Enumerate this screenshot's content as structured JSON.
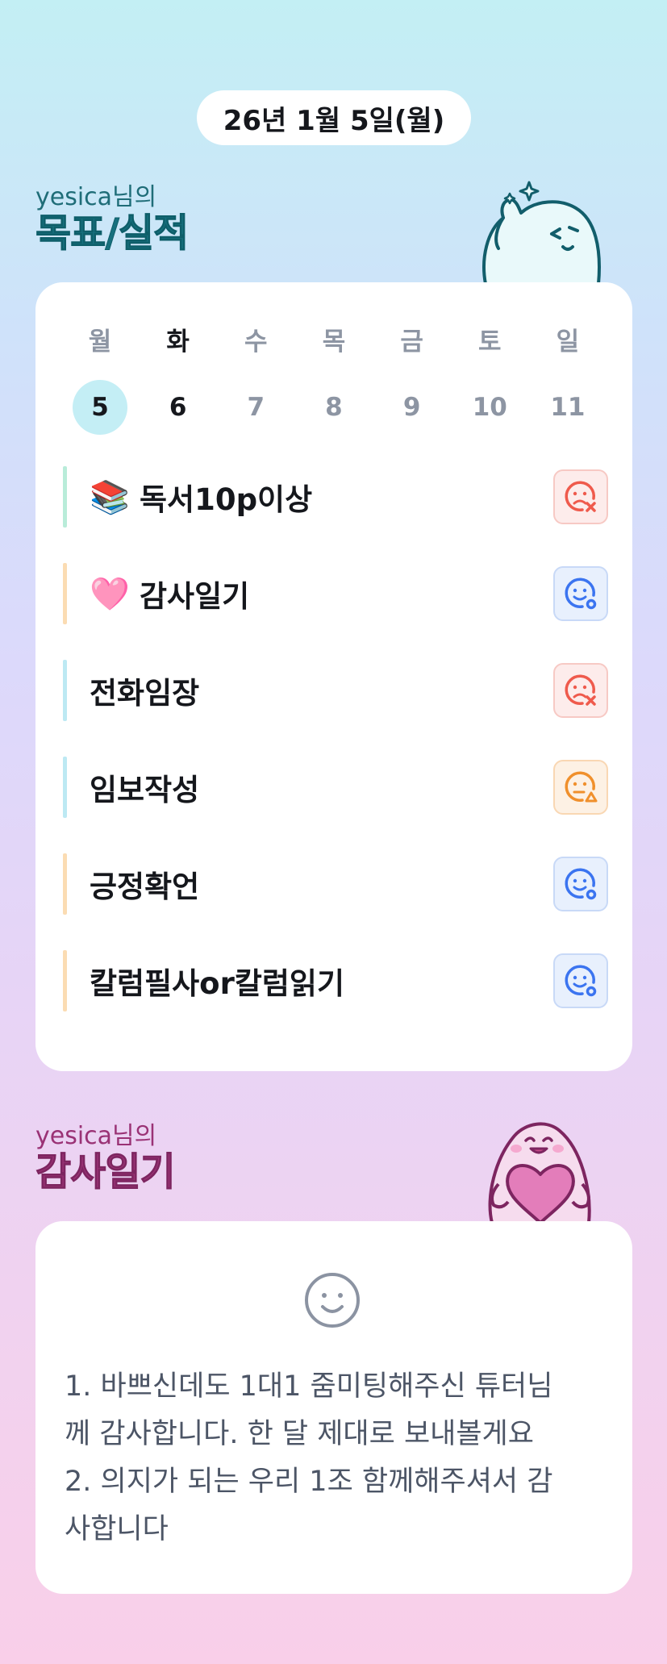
{
  "header": {
    "date": "26년 1월 5일(월)"
  },
  "goals_section": {
    "owner": "yesica님의",
    "title": "목표/실적"
  },
  "week": {
    "days": [
      {
        "weekday": "월",
        "day": "5"
      },
      {
        "weekday": "화",
        "day": "6"
      },
      {
        "weekday": "수",
        "day": "7"
      },
      {
        "weekday": "목",
        "day": "8"
      },
      {
        "weekday": "금",
        "day": "9"
      },
      {
        "weekday": "토",
        "day": "10"
      },
      {
        "weekday": "일",
        "day": "11"
      }
    ],
    "selected_day": "5",
    "today_weekday": "화"
  },
  "goals": [
    {
      "emoji": "📚",
      "label": "독서10p이상",
      "status": "fail",
      "status_icon": "sad-face-x-icon",
      "bar_color": "#b9ecd9"
    },
    {
      "emoji": "🩷",
      "label": "감사일기",
      "status": "done",
      "status_icon": "smile-face-o-icon",
      "bar_color": "#fbdcb3"
    },
    {
      "emoji": "",
      "label": "전화임장",
      "status": "fail",
      "status_icon": "sad-face-x-icon",
      "bar_color": "#bde9f3"
    },
    {
      "emoji": "",
      "label": "임보작성",
      "status": "partial",
      "status_icon": "neutral-face-triangle-icon",
      "bar_color": "#bde9f3"
    },
    {
      "emoji": "",
      "label": "긍정확언",
      "status": "done",
      "status_icon": "smile-face-o-icon",
      "bar_color": "#fbdcb3"
    },
    {
      "emoji": "",
      "label": "칼럼필사or칼럼읽기",
      "status": "done",
      "status_icon": "smile-face-o-icon",
      "bar_color": "#fbdcb3"
    }
  ],
  "gratitude_section": {
    "owner": "yesica님의",
    "title": "감사일기",
    "mood_icon": "smile-icon",
    "lines": [
      "1. 바쁘신데도 1대1 줌미팅해주신 튜터님",
      "께 감사합니다. 한 달 제대로 보내볼게요",
      "2. 의지가 되는 우리 1조 함께해주셔서 감",
      "사합니다"
    ]
  },
  "colors": {
    "fail": "#ef5a4c",
    "done": "#3b74f0",
    "partial": "#f0902c"
  }
}
